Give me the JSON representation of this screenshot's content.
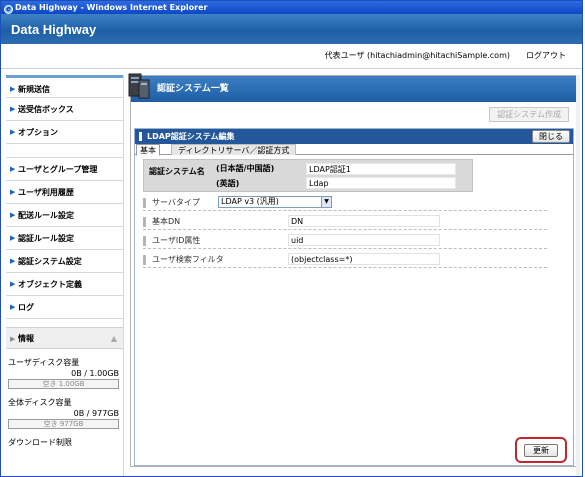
{
  "window": {
    "title": "Data Highway - Windows Internet Explorer"
  },
  "app": {
    "title": "Data Highway"
  },
  "userbar": {
    "user": "代表ユーザ (hitachiadmin@hitachiSample.com)",
    "logout": "ログアウト"
  },
  "sidebar": {
    "items": [
      "新規送信",
      "送受信ボックス",
      "オプション",
      "ユーザとグループ管理",
      "ユーザ利用履歴",
      "配送ルール設定",
      "認証ルール設定",
      "認証システム設定",
      "オブジェクト定義",
      "ログ"
    ],
    "info": {
      "title": "情報",
      "user_disk_label": "ユーザディスク容量",
      "user_disk_value": "0B / 1.00GB",
      "user_disk_free": "空き 1.00GB",
      "total_disk_label": "全体ディスク容量",
      "total_disk_value": "0B / 977GB",
      "total_disk_free": "空き 977GB",
      "download_limit_label": "ダウンロード制限"
    }
  },
  "main": {
    "section_title": "認証システム一覧",
    "create_button": "認証システム作成",
    "panel_title": "LDAP認証システム編集",
    "close_button": "閉じる",
    "tabs": [
      "基本",
      "ディレクトリサーバ／認証方式"
    ],
    "auth_name_label": "認証システム名",
    "auth_name_ja_label": "(日本語/中国語)",
    "auth_name_en_label": "(英語)",
    "auth_name_ja_value": "LDAP認証1",
    "auth_name_en_value": "Ldap",
    "server_type_label": "サーバタイプ",
    "server_type_value": "LDAP v3 (汎用)",
    "base_dn_label": "基本DN",
    "base_dn_value": "DN",
    "user_id_attr_label": "ユーザID属性",
    "user_id_attr_value": "uid",
    "user_filter_label": "ユーザ検索フィルタ",
    "user_filter_value": "(objectclass=*)",
    "update_button": "更新"
  },
  "colors": {
    "accent": "#1d5ea4",
    "highlight": "#c0282d"
  }
}
